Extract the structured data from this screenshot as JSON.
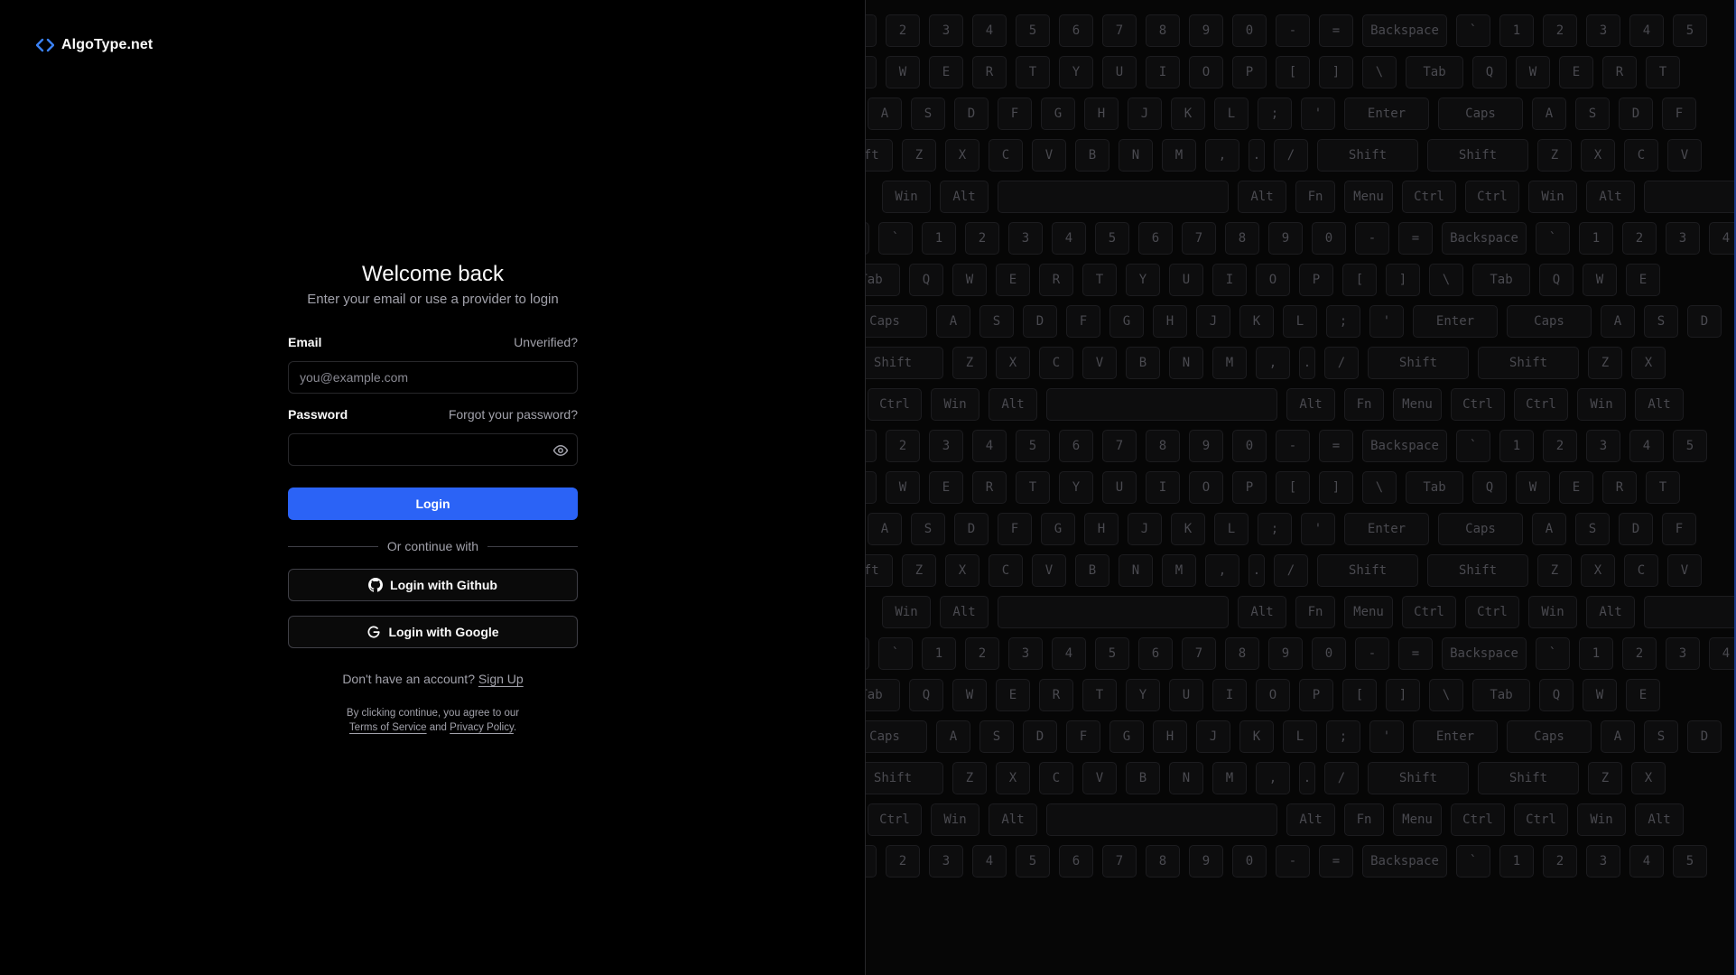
{
  "brand": {
    "name": "AlgoType.net",
    "icon": "code-brackets-icon",
    "icon_color": "#3b82f6"
  },
  "login": {
    "title": "Welcome back",
    "subtitle": "Enter your email or use a provider to login",
    "email_label": "Email",
    "unverified_link": "Unverified?",
    "email_placeholder": "you@example.com",
    "email_value": "",
    "password_label": "Password",
    "forgot_link": "Forgot your password?",
    "password_value": "",
    "login_button": "Login",
    "divider_text": "Or continue with",
    "github_button": "Login with Github",
    "google_button": "Login with Google",
    "signup_prompt": "Don't have an account?",
    "signup_link": "Sign Up",
    "terms_prefix": "By clicking continue, you agree to our",
    "terms_link": "Terms of Service",
    "terms_and": "and",
    "privacy_link": "Privacy Policy",
    "terms_suffix": "."
  },
  "colors": {
    "primary": "#2b63f6",
    "background": "#000000"
  },
  "keyboard_rows": [
    [
      "1",
      "2",
      "3",
      "4",
      "5",
      "6",
      "7",
      "8",
      "9",
      "0",
      "-",
      "=",
      "Backspace",
      "`",
      "1",
      "2",
      "3",
      "4",
      "5"
    ],
    [
      "Q",
      "W",
      "E",
      "R",
      "T",
      "Y",
      "U",
      "I",
      "O",
      "P",
      "[",
      "]",
      "\\",
      "Tab",
      "Q",
      "W",
      "E",
      "R",
      "T"
    ],
    [
      "s",
      "A",
      "S",
      "D",
      "F",
      "G",
      "H",
      "J",
      "K",
      "L",
      ";",
      "'",
      "Enter",
      "Caps",
      "A",
      "S",
      "D",
      "F"
    ],
    [
      "ift",
      "Z",
      "X",
      "C",
      "V",
      "B",
      "N",
      "M",
      ",",
      ".",
      "/",
      "Shift",
      "Shift",
      "Z",
      "X",
      "C",
      "V"
    ],
    [
      "Win",
      "Alt",
      "",
      "Alt",
      "Fn",
      "Menu",
      "Ctrl",
      "Ctrl",
      "Win",
      "Alt",
      ""
    ],
    [
      "ce",
      "`",
      "1",
      "2",
      "3",
      "4",
      "5",
      "6",
      "7",
      "8",
      "9",
      "0",
      "-",
      "=",
      "Backspace",
      "`",
      "1",
      "2",
      "3",
      "4"
    ],
    [
      "Tab",
      "Q",
      "W",
      "E",
      "R",
      "T",
      "Y",
      "U",
      "I",
      "O",
      "P",
      "[",
      "]",
      "\\",
      "Tab",
      "Q",
      "W",
      "E"
    ],
    [
      "Caps",
      "A",
      "S",
      "D",
      "F",
      "G",
      "H",
      "J",
      "K",
      "L",
      ";",
      "'",
      "Enter",
      "Caps",
      "A",
      "S",
      "D"
    ],
    [
      "Shift",
      "Z",
      "X",
      "C",
      "V",
      "B",
      "N",
      "M",
      ",",
      ".",
      "/",
      "Shift",
      "Shift",
      "Z",
      "X"
    ],
    [
      ".",
      "Ctrl",
      "Win",
      "Alt",
      "",
      "Alt",
      "Fn",
      "Menu",
      "Ctrl",
      "Ctrl",
      "Win",
      "Alt"
    ]
  ]
}
